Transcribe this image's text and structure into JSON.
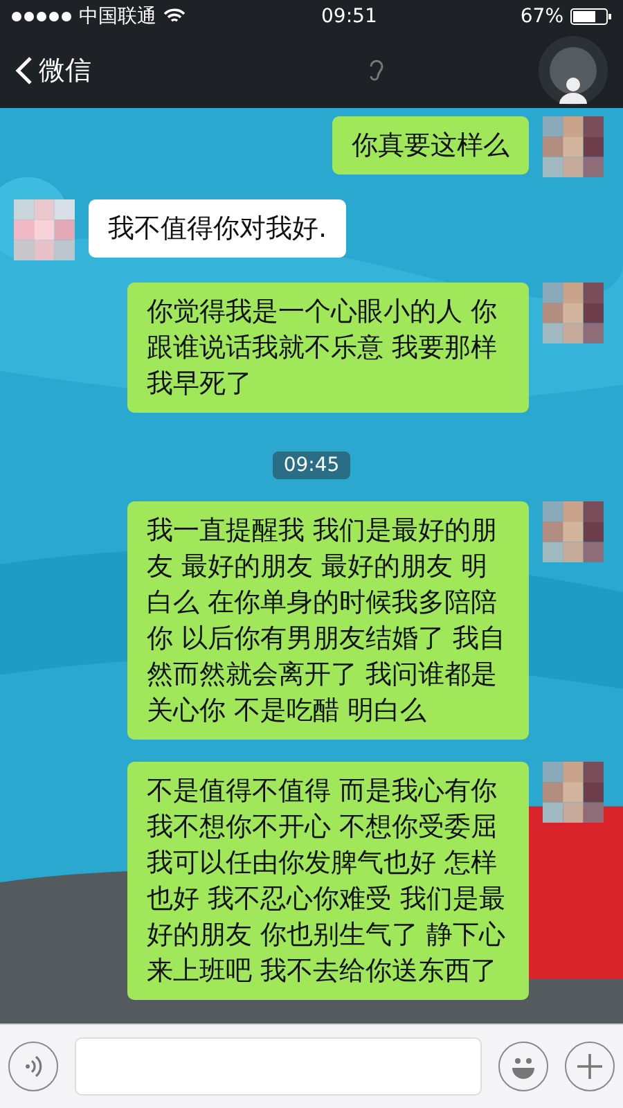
{
  "status_bar": {
    "carrier": "中国联通",
    "time": "09:51",
    "battery": "67%"
  },
  "nav": {
    "back": "微信"
  },
  "messages": [
    {
      "kind": "sent",
      "text": "你真要这样么"
    },
    {
      "kind": "received",
      "text": "我不值得你对我好."
    },
    {
      "kind": "sent",
      "text": "你觉得我是一个心眼小的人 你跟谁说话我就不乐意 我要那样我早死了"
    },
    {
      "kind": "time",
      "text": "09:45"
    },
    {
      "kind": "sent",
      "text": "我一直提醒我 我们是最好的朋友 最好的朋友 最好的朋友 明白么 在你单身的时候我多陪陪你 以后你有男朋友结婚了 我自然而然就会离开了 我问谁都是关心你 不是吃醋 明白么"
    },
    {
      "kind": "sent",
      "text": "不是值得不值得 而是我心有你我不想你不开心 不想你受委屈我可以任由你发脾气也好 怎样也好 我不忍心你难受 我们是最好的朋友 你也别生气了 静下心来上班吧 我不去给你送东西了"
    }
  ]
}
